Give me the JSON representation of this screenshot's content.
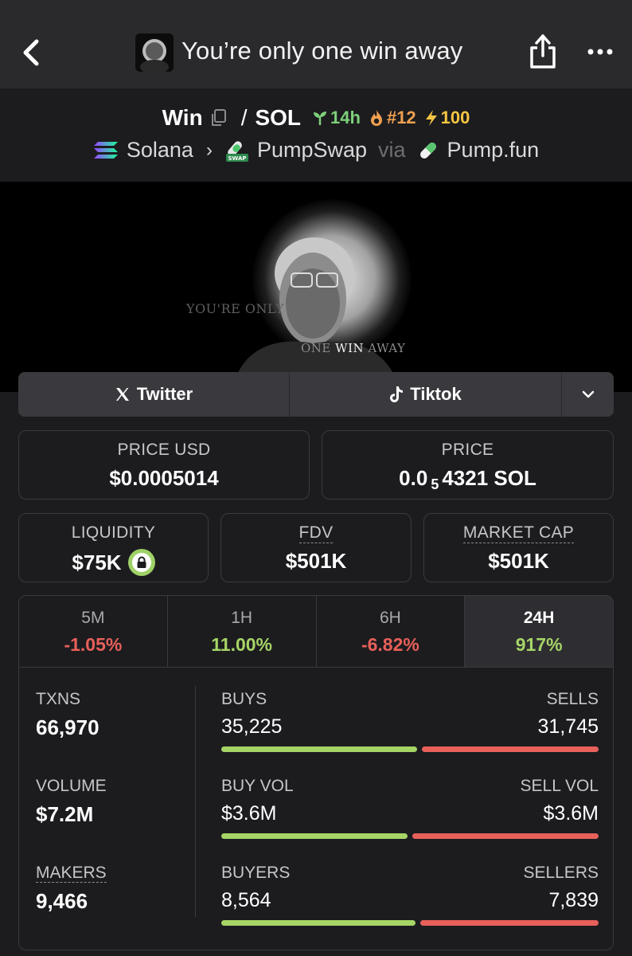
{
  "nav": {
    "title": "You’re only one win away",
    "back_icon": "chevron-left-icon",
    "share_icon": "share-icon",
    "more_icon": "more-horizontal-icon"
  },
  "token": {
    "symbol": "Win",
    "quote": "SOL",
    "age": "14h",
    "rank": "#12",
    "boost": "100",
    "chain": "Solana",
    "dex": "PumpSwap",
    "via_label": "via",
    "launchpad": "Pump.fun"
  },
  "banner": {
    "line1": "YOU'RE ONLY",
    "line2_a": "ONE",
    "line2_b": "WIN",
    "line2_c": "AWAY"
  },
  "social": {
    "twitter": "Twitter",
    "tiktok": "Tiktok"
  },
  "prices": {
    "price_usd_label": "PRICE USD",
    "price_usd": "$0.0005014",
    "price_label": "PRICE",
    "price_sol_prefix": "0.0",
    "price_sol_sub": "5",
    "price_sol_suffix": "4321 SOL"
  },
  "metrics": {
    "liquidity_label": "LIQUIDITY",
    "liquidity": "$75K",
    "fdv_label": "FDV",
    "fdv": "$501K",
    "mcap_label": "MARKET CAP",
    "mcap": "$501K"
  },
  "timeframes": [
    {
      "label": "5M",
      "value": "-1.05%"
    },
    {
      "label": "1H",
      "value": "11.00%"
    },
    {
      "label": "6H",
      "value": "-6.82%"
    },
    {
      "label": "24H",
      "value": "917%"
    }
  ],
  "stats": {
    "txns_label": "TXNS",
    "txns": "66,970",
    "volume_label": "VOLUME",
    "volume": "$7.2M",
    "makers_label": "MAKERS",
    "makers": "9,466",
    "buys_label": "BUYS",
    "buys": "35,225",
    "sells_label": "SELLS",
    "sells": "31,745",
    "buy_vol_label": "BUY VOL",
    "buy_vol": "$3.6M",
    "sell_vol_label": "SELL VOL",
    "sell_vol": "$3.6M",
    "buyers_label": "BUYERS",
    "buyers": "8,564",
    "sellers_label": "SELLERS",
    "sellers": "7,839",
    "buys_ratio": 0.526,
    "buy_vol_ratio": 0.5,
    "buyers_ratio": 0.522
  },
  "colors": {
    "positive": "#a6d566",
    "negative": "#e8605a",
    "boost": "#f5c542",
    "rank": "#f0a050",
    "age": "#7ed07a"
  }
}
